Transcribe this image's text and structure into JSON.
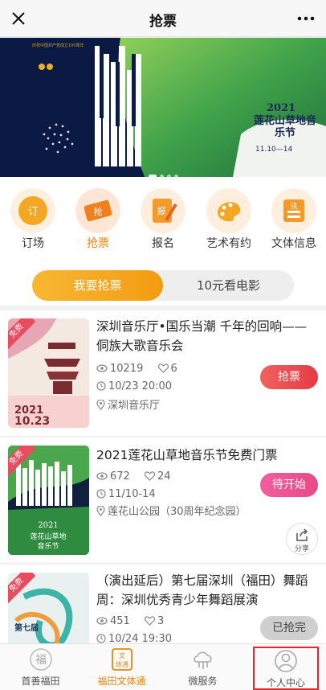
{
  "header": {
    "title": "抢票",
    "close_icon": "close-icon",
    "more_icon": "more-icon"
  },
  "banner": {
    "year": "2021",
    "name": "莲花山草地音乐节",
    "date": "11.10—14",
    "note": "庆祝中国共产党成立100周年",
    "slides": 4,
    "active_slide": 0
  },
  "categories": [
    {
      "label": "订场",
      "icon": "venue-booking-icon"
    },
    {
      "label": "抢票",
      "icon": "ticket-icon",
      "active": true
    },
    {
      "label": "报名",
      "icon": "signup-icon"
    },
    {
      "label": "艺术有约",
      "icon": "art-palette-icon"
    },
    {
      "label": "文体信息",
      "icon": "info-icon"
    }
  ],
  "segment": {
    "active": "我要抢票",
    "inactive": "10元看电影"
  },
  "events": [
    {
      "title": "深圳音乐厅•国乐当潮 千年的回响——侗族大歌音乐会",
      "views": "10219",
      "likes": "6",
      "time": "10/23 20:00",
      "location": "深圳音乐厅",
      "status": "抢票",
      "tag": "免费",
      "poster_date": "2021 10.23"
    },
    {
      "title": "2021莲花山草地音乐节免费门票",
      "views": "672",
      "likes": "24",
      "time": "11/10-14",
      "location": "莲花山公园（30周年纪念园）",
      "status": "待开始",
      "tag": "免费",
      "poster_date": "2021 莲花山草地音乐节"
    },
    {
      "title": "（演出延后）第七届深圳（福田）舞蹈周：深圳优秀青少年舞蹈展演",
      "views": "451",
      "likes": "3",
      "time": "10/24 19:30",
      "location": "",
      "status": "已抢完",
      "tag": "免费",
      "poster_date": "第七届 深圳（福田）舞蹈周"
    }
  ],
  "share_label": "分享",
  "tabbar": [
    {
      "label": "首善福田",
      "icon": "fu-character-icon"
    },
    {
      "label": "福田文体通",
      "icon": "wentitong-icon",
      "active": true
    },
    {
      "label": "微服务",
      "icon": "cloud-service-icon"
    },
    {
      "label": "个人中心",
      "icon": "user-icon",
      "highlight": true
    }
  ],
  "colors": {
    "accent": "#e8860a",
    "red": "#e63b46",
    "pink": "#e84a86",
    "highlight_box": "#e0282e"
  }
}
